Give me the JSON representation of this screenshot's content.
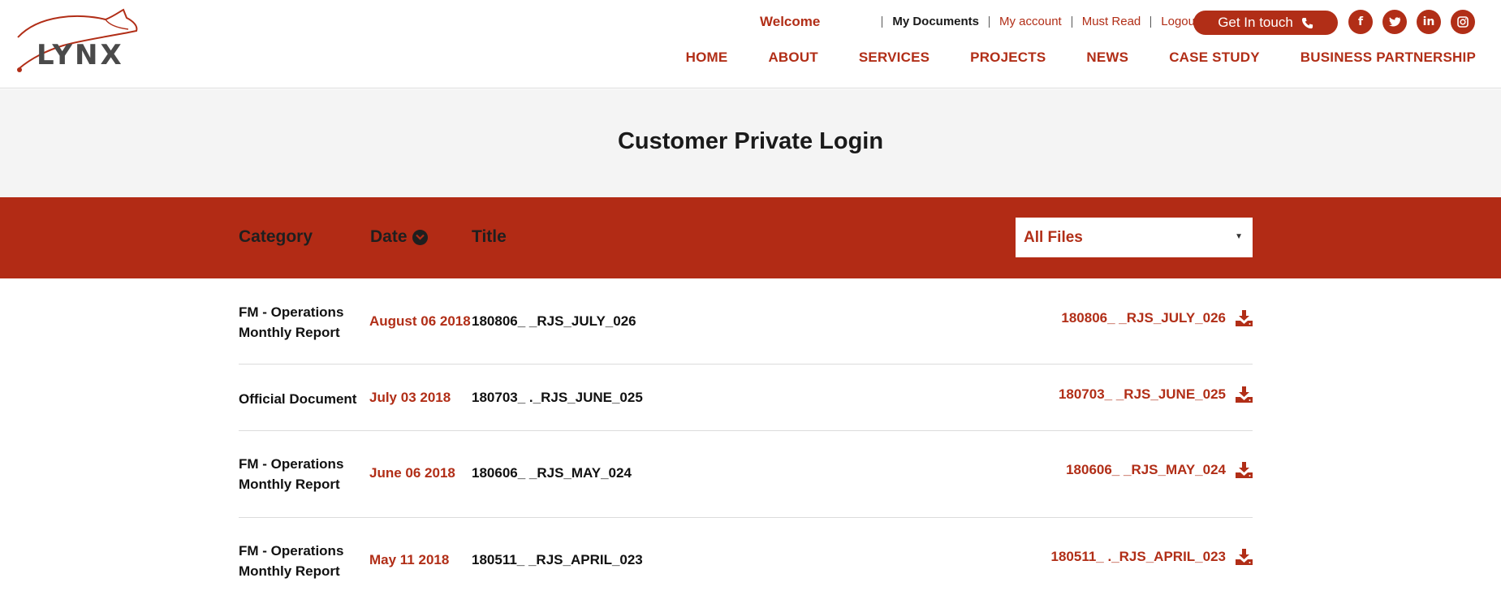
{
  "brand": {
    "logo_text": "LYNX"
  },
  "topbar": {
    "welcome": "Welcome",
    "links": [
      "My Documents",
      "My account",
      "Must Read",
      "Logout"
    ],
    "cta_label": "Get In touch"
  },
  "social": [
    "f",
    "t",
    "in",
    "ig"
  ],
  "nav": [
    "HOME",
    "ABOUT",
    "SERVICES",
    "PROJECTS",
    "NEWS",
    "CASE STUDY",
    "BUSINESS PARTNERSHIP"
  ],
  "page_title": "Customer Private Login",
  "table": {
    "headers": {
      "category": "Category",
      "date": "Date",
      "title": "Title"
    },
    "filter": {
      "selected": "All Files"
    },
    "rows": [
      {
        "category": "FM - Operations Monthly Report",
        "date": "August 06 2018",
        "title": "180806_        _RJS_JULY_026",
        "file": "180806_        _RJS_JULY_026"
      },
      {
        "category": "Official Document",
        "date": "July 03 2018",
        "title": "180703_       ._RJS_JUNE_025",
        "file": "180703_       _RJS_JUNE_025"
      },
      {
        "category": "FM - Operations Monthly Report",
        "date": "June 06 2018",
        "title": "180606_        _RJS_MAY_024",
        "file": "180606_        _RJS_MAY_024"
      },
      {
        "category": "FM - Operations Monthly Report",
        "date": "May 11 2018",
        "title": "180511_        _RJS_APRIL_023",
        "file": "180511_       ._RJS_APRIL_023"
      }
    ]
  },
  "colors": {
    "accent": "#b12e17",
    "band": "#f4f4f4"
  },
  "icons": {
    "cta": "phone-icon",
    "sort": "chevron-down-circle-icon",
    "download": "download-icon"
  }
}
